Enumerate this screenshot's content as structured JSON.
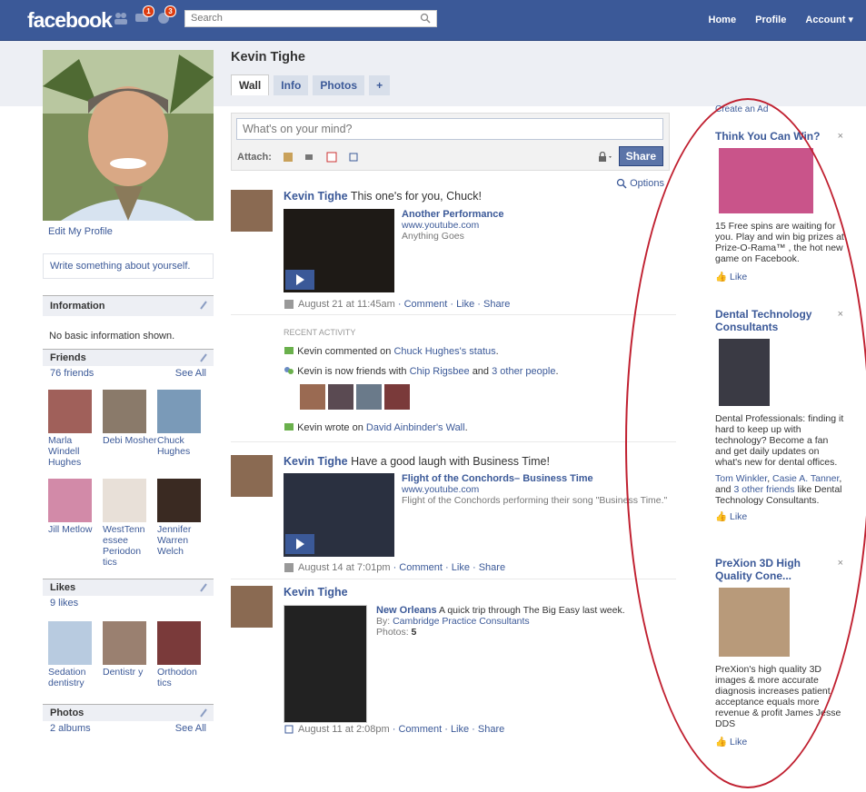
{
  "topbar": {
    "logo": "facebook",
    "badge_friends": "1",
    "badge_notifications": "3",
    "search_placeholder": "Search",
    "nav": [
      "Home",
      "Profile",
      "Account ▾"
    ]
  },
  "profile": {
    "name": "Kevin Tighe",
    "tabs": [
      "Wall",
      "Info",
      "Photos",
      "+"
    ],
    "edit_profile": "Edit My Profile",
    "write_about": "Write something about yourself."
  },
  "information": {
    "header": "Information",
    "text": "No basic information shown."
  },
  "friends": {
    "header": "Friends",
    "count": "76 friends",
    "see_all": "See All",
    "items": [
      {
        "name": "Marla Windell Hughes"
      },
      {
        "name": "Debi Mosher"
      },
      {
        "name": "Chuck Hughes"
      },
      {
        "name": "Jill Metlow"
      },
      {
        "name": "WestTenn essee Periodon tics"
      },
      {
        "name": "Jennifer Warren Welch"
      }
    ]
  },
  "likes": {
    "header": "Likes",
    "count": "9 likes",
    "items": [
      {
        "name": "Sedation dentistry"
      },
      {
        "name": "Dentistr y"
      },
      {
        "name": "Orthodon tics"
      }
    ]
  },
  "photos": {
    "header": "Photos",
    "count": "2 albums",
    "see_all": "See All"
  },
  "composer": {
    "placeholder": "What's on your mind?",
    "attach_label": "Attach:",
    "share": "Share",
    "options": "Options"
  },
  "stories": [
    {
      "author": "Kevin Tighe",
      "text": "This one's for you, Chuck!",
      "video_title": "Another Performance",
      "video_url": "www.youtube.com",
      "video_desc": "Anything Goes",
      "time": "August 21 at 11:45am",
      "actions": "· Comment · Like · Share"
    },
    {
      "author": "Kevin Tighe",
      "text": "Have a good laugh with Business Time!",
      "video_title": "Flight of the Conchords– Business Time",
      "video_url": "www.youtube.com",
      "video_desc": "Flight of the Conchords performing their song \"Business Time.\"",
      "time": "August 14 at 7:01pm",
      "actions": "· Comment · Like · Share"
    },
    {
      "author": "Kevin Tighe",
      "album_title": "New Orleans",
      "album_desc": "A quick trip through The Big Easy last week.",
      "by_label": "By:",
      "by": "Cambridge Practice Consultants",
      "photos_label": "Photos:",
      "photos_count": "5",
      "time": "August 11 at 2:08pm",
      "actions": "· Comment · Like · Share"
    }
  ],
  "recent_activity": {
    "header": "RECENT ACTIVITY",
    "line1_prefix": "Kevin commented on",
    "line1_link": "Chuck Hughes's status",
    "line1_suffix": ".",
    "line2_prefix": "Kevin is now friends with",
    "line2_link1": "Chip Rigsbee",
    "line2_mid": "and",
    "line2_link2": "3 other people",
    "line2_suffix": ".",
    "line3_prefix": "Kevin wrote on",
    "line3_link": "David Ainbinder's Wall",
    "line3_suffix": "."
  },
  "ads": {
    "create": "Create an Ad",
    "items": [
      {
        "title": "Think You Can Win?",
        "body": "15 Free spins are waiting for you. Play and win big prizes at Prize-O-Rama™ , the hot new game on Facebook.",
        "like": "Like"
      },
      {
        "title": "Dental Technology Consultants",
        "body": "Dental Professionals: finding it hard to keep up with technology? Become a fan and get daily updates on what's new for dental offices.",
        "social_link1": "Tom Winkler",
        "social_sep": ", ",
        "social_link2": "Casie A. Tanner",
        "social_mid": ", and ",
        "social_link3": "3 other friends",
        "social_suffix": " like Dental Technology Consultants.",
        "like": "Like"
      },
      {
        "title": "PreXion 3D High Quality Cone...",
        "body": "PreXion's high quality 3D images & more accurate diagnosis increases patient acceptance equals more revenue & profit James Jesse DDS",
        "like": "Like"
      }
    ]
  },
  "colors": {
    "brand": "#3b5998",
    "highlight_oval": "#c02030"
  }
}
